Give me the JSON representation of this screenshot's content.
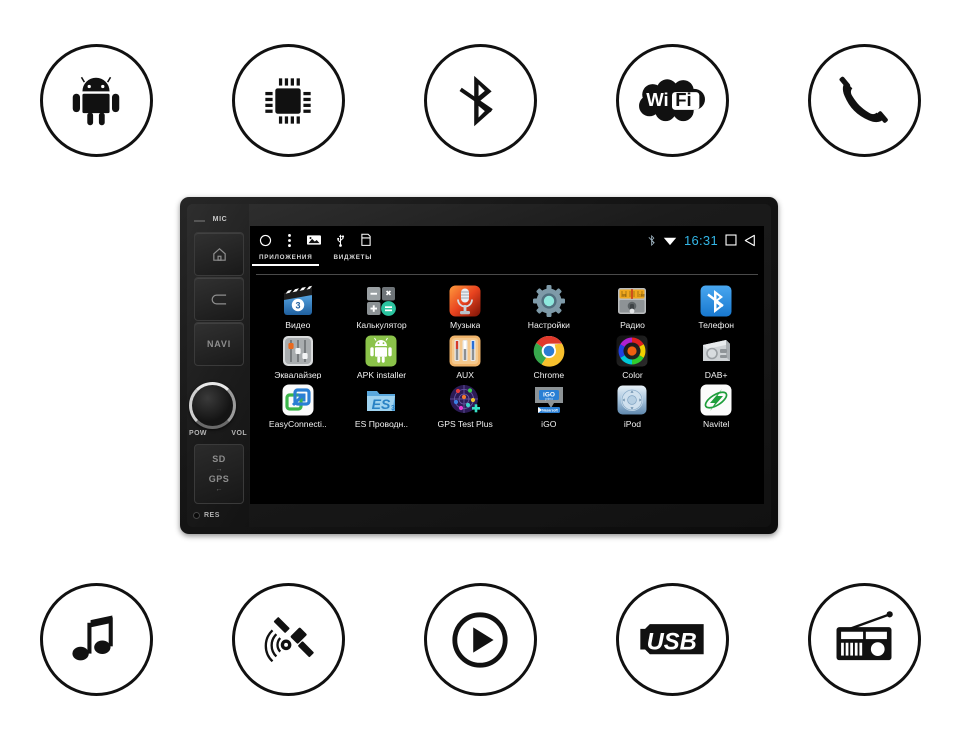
{
  "feature_icons": {
    "top": [
      {
        "name": "android-icon",
        "label": "Android"
      },
      {
        "name": "cpu-chip-icon",
        "label": "CPU"
      },
      {
        "name": "bluetooth-icon",
        "label": "Bluetooth"
      },
      {
        "name": "wifi-icon",
        "label": "Wi-Fi"
      },
      {
        "name": "phone-handset-icon",
        "label": "Phone"
      }
    ],
    "bottom": [
      {
        "name": "music-note-icon",
        "label": "Music"
      },
      {
        "name": "gps-satellite-icon",
        "label": "GPS"
      },
      {
        "name": "play-button-icon",
        "label": "Play"
      },
      {
        "name": "usb-icon",
        "label": "USB"
      },
      {
        "name": "radio-icon",
        "label": "Radio"
      }
    ]
  },
  "head_unit": {
    "left_panel": {
      "mic_label": "MIC",
      "buttons": [
        {
          "name": "home-button",
          "label": ""
        },
        {
          "name": "back-button",
          "label": ""
        },
        {
          "name": "navi-button",
          "label": "NAVI"
        }
      ],
      "knob": {
        "power_label": "POW",
        "volume_label": "VOL"
      },
      "card_slot": {
        "sd_label": "SD",
        "gps_label": "GPS"
      },
      "reset": {
        "label": "RES"
      }
    },
    "screen": {
      "statusbar": {
        "left_icons": [
          "home-circle-icon",
          "overflow-menu-icon",
          "image-icon",
          "usb-icon",
          "sd-card-icon"
        ],
        "right_icons": [
          "bluetooth-status-icon",
          "wifi-status-icon"
        ],
        "clock": "16:31",
        "nav_icons": [
          "recents-square-icon",
          "back-triangle-icon"
        ],
        "clock_color": "#33b5e5"
      },
      "tabs": [
        {
          "label": "ПРИЛОЖЕНИЯ",
          "active": true
        },
        {
          "label": "ВИДЖЕТЫ",
          "active": false
        }
      ],
      "apps": [
        {
          "label": "Видео",
          "icon": "video-icon",
          "badge": "3"
        },
        {
          "label": "Калькулятор",
          "icon": "calculator-icon"
        },
        {
          "label": "Музыка",
          "icon": "music-icon"
        },
        {
          "label": "Настройки",
          "icon": "settings-icon"
        },
        {
          "label": "Радио",
          "icon": "radio-app-icon"
        },
        {
          "label": "Телефон",
          "icon": "phone-bluetooth-icon"
        },
        {
          "label": "Эквалайзер",
          "icon": "equalizer-icon"
        },
        {
          "label": "APK installer",
          "icon": "apk-installer-icon"
        },
        {
          "label": "AUX",
          "icon": "aux-icon"
        },
        {
          "label": "Chrome",
          "icon": "chrome-icon"
        },
        {
          "label": "Color",
          "icon": "color-icon"
        },
        {
          "label": "DAB+",
          "icon": "dab-icon"
        },
        {
          "label": "EasyConnecti..",
          "icon": "easyconnection-icon"
        },
        {
          "label": "ES Проводн..",
          "icon": "es-explorer-icon"
        },
        {
          "label": "GPS Test Plus",
          "icon": "gps-test-plus-icon"
        },
        {
          "label": "iGO",
          "icon": "igo-icon"
        },
        {
          "label": "iPod",
          "icon": "ipod-icon"
        },
        {
          "label": "Navitel",
          "icon": "navitel-icon"
        }
      ]
    }
  }
}
